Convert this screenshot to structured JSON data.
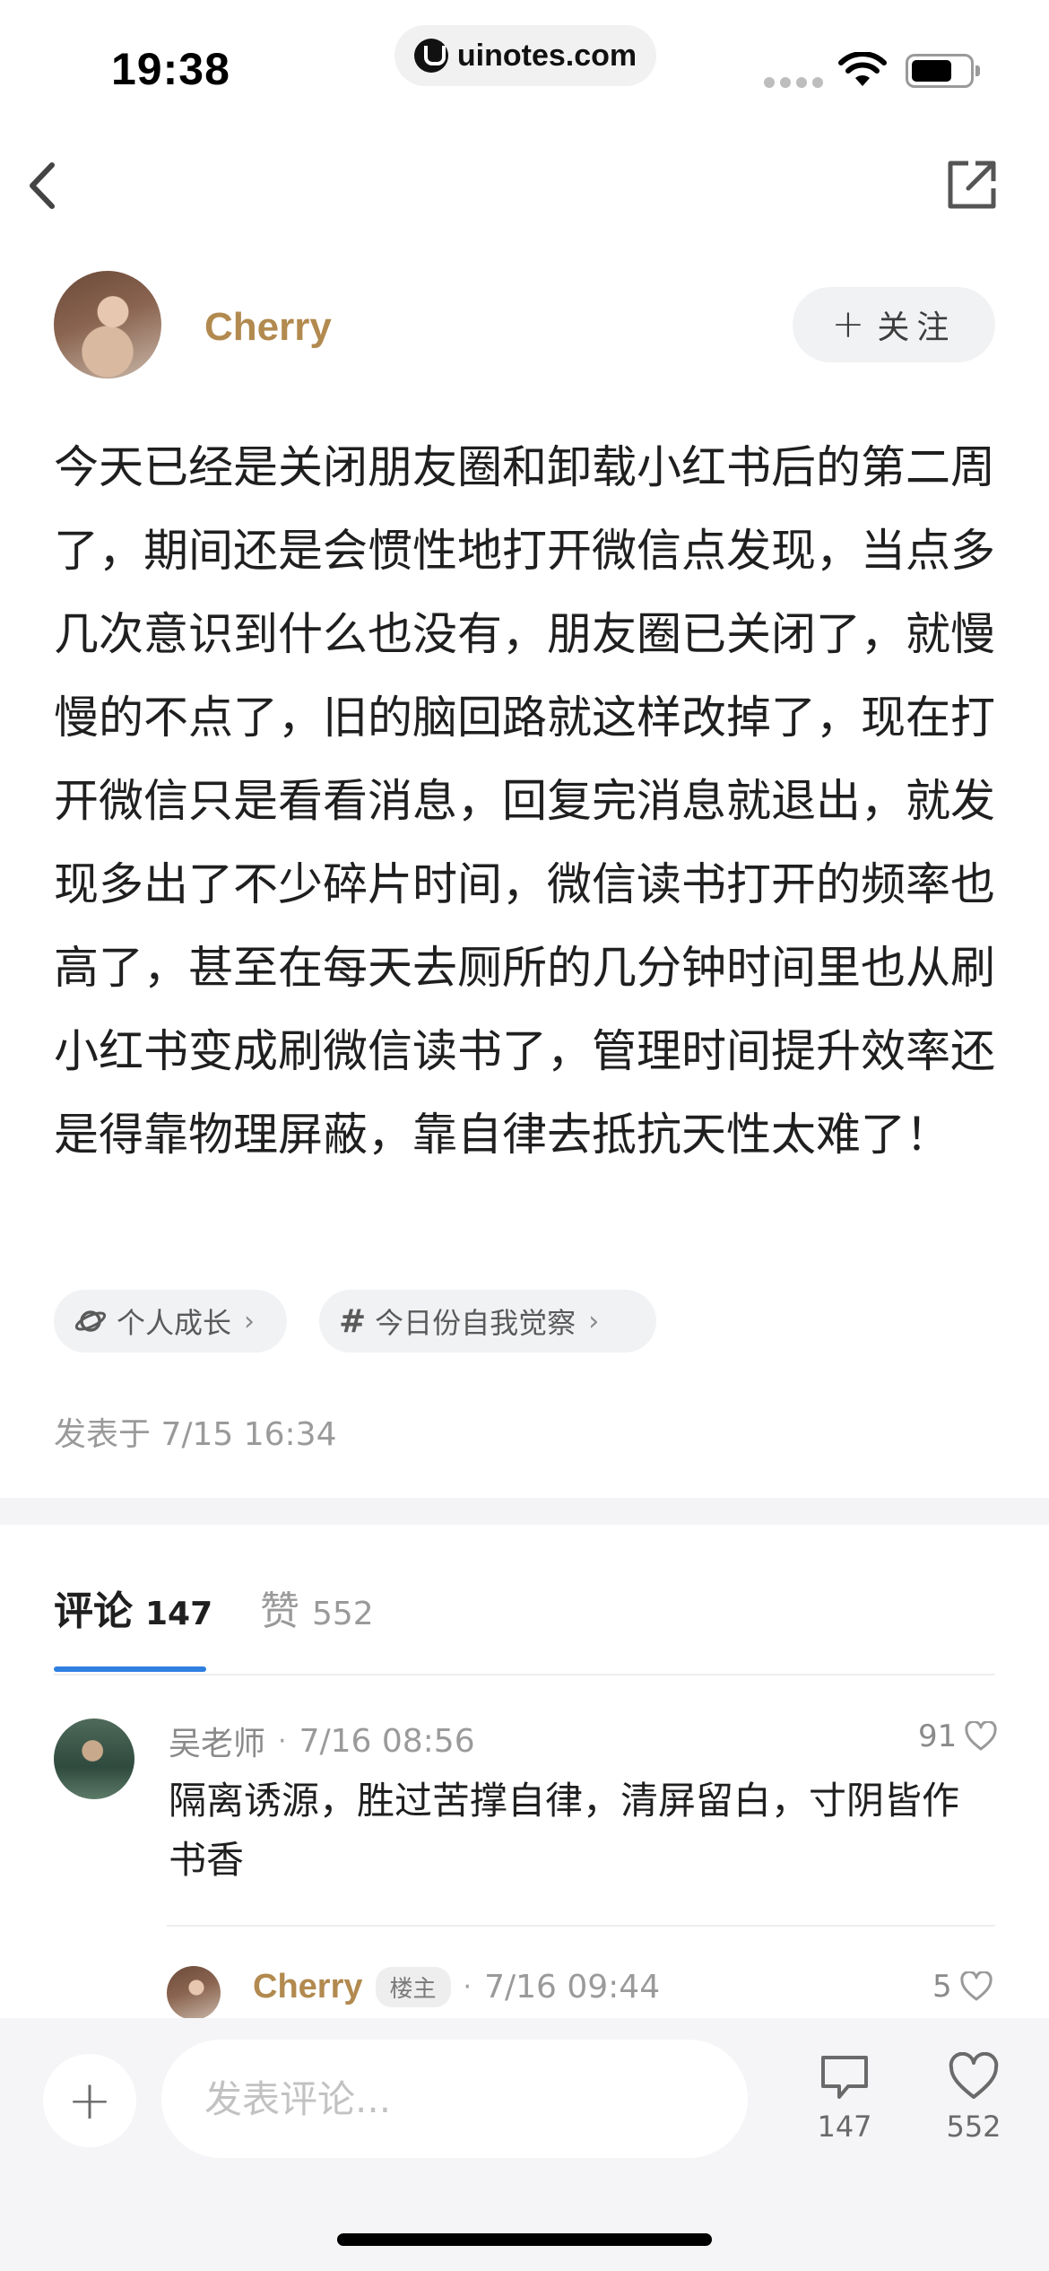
{
  "status_bar": {
    "time": "19:38",
    "url": "uinotes.com"
  },
  "nav": {
    "back_icon": "chevron-left-icon",
    "share_icon": "share-external-icon"
  },
  "author": {
    "name": "Cherry",
    "follow_label": "关注",
    "follow_icon": "plus-icon"
  },
  "post": {
    "content": "今天已经是关闭朋友圈和卸载小红书后的第二周了，期间还是会惯性地打开微信点发现，当点多几次意识到什么也没有，朋友圈已关闭了，就慢慢的不点了，旧的脑回路就这样改掉了，现在打开微信只是看看消息，回复完消息就退出，就发现多出了不少碎片时间，微信读书打开的频率也高了，甚至在每天去厕所的几分钟时间里也从刷小红书变成刷微信读书了，管理时间提升效率还是得靠物理屏蔽，靠自律去抵抗天性太难了！",
    "tags": [
      {
        "label": "个人成长",
        "icon": "planet-icon"
      },
      {
        "label": "今日份自我觉察",
        "icon": "hash-icon"
      }
    ],
    "published": "发表于 7/15 16:34"
  },
  "tabs": {
    "comments_label": "评论",
    "comments_count": "147",
    "likes_label": "赞",
    "likes_count": "552",
    "active": "comments"
  },
  "comments": [
    {
      "name": "吴老师",
      "time": "7/16 08:56",
      "likes": "91",
      "text": "隔离诱源，胜过苦撑自律，清屏留白，寸阴皆作书香"
    },
    {
      "name": "Cherry",
      "badge": "楼主",
      "time": "7/16 09:44",
      "likes": "5"
    }
  ],
  "bottom_bar": {
    "add_icon": "plus-icon",
    "input_placeholder": "发表评论...",
    "comment_count": "147",
    "like_count": "552"
  },
  "colors": {
    "author_gold": "#b28a4f",
    "tab_indicator": "#2f7fe0",
    "muted_text": "#9a9a9a"
  }
}
